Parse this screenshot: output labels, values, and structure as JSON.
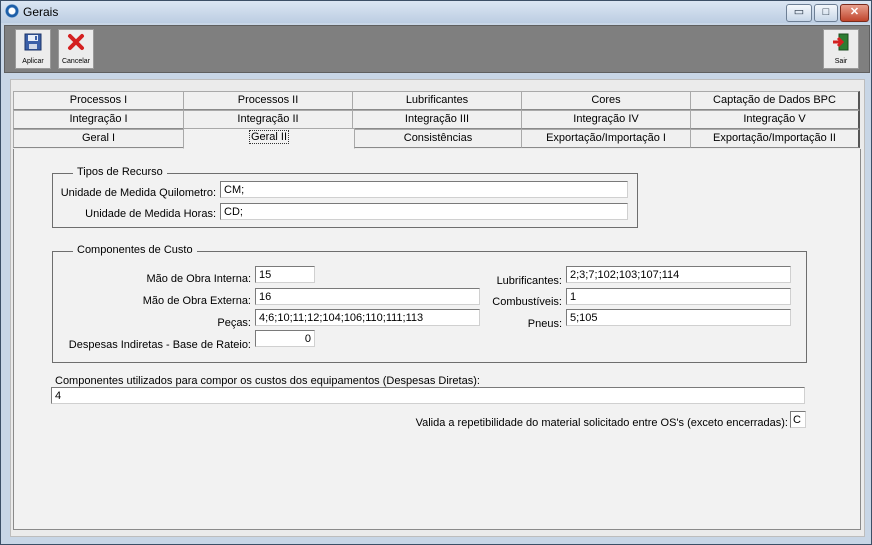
{
  "window": {
    "title": "Gerais",
    "minimize": "▭",
    "maximize": "□",
    "close": "✕"
  },
  "toolbar": {
    "apply_label": "Aplicar",
    "cancel_label": "Cancelar",
    "exit_label": "Sair"
  },
  "tabs": {
    "row1": [
      "Processos I",
      "Processos II",
      "Lubrificantes",
      "Cores",
      "Captação de Dados BPC"
    ],
    "row2": [
      "Integração I",
      "Integração II",
      "Integração III",
      "Integração IV",
      "Integração V"
    ],
    "row3": [
      "Geral I",
      "Geral II",
      "Consistências",
      "Exportação/Importação I",
      "Exportação/Importação II"
    ],
    "active": "Geral II"
  },
  "tipos_recurso": {
    "title": "Tipos de Recurso",
    "quilometro_label": "Unidade de Medida Quilometro:",
    "quilometro_value": "CM;",
    "horas_label": "Unidade de Medida Horas:",
    "horas_value": "CD;"
  },
  "componentes_custo": {
    "title": "Componentes de Custo",
    "mao_obra_interna_label": "Mão de Obra Interna:",
    "mao_obra_interna_value": "15",
    "mao_obra_externa_label": "Mão de Obra Externa:",
    "mao_obra_externa_value": "16",
    "pecas_label": "Peças:",
    "pecas_value": "4;6;10;11;12;104;106;110;111;113",
    "despesas_label": "Despesas Indiretas - Base de Rateio:",
    "despesas_value": "0",
    "lubrificantes_label": "Lubrificantes:",
    "lubrificantes_value": "2;3;7;102;103;107;114",
    "combustiveis_label": "Combustíveis:",
    "combustiveis_value": "1",
    "pneus_label": "Pneus:",
    "pneus_value": "5;105"
  },
  "despesas_diretas": {
    "label": "Componentes utilizados para compor os custos dos equipamentos (Despesas Diretas):",
    "value": "4"
  },
  "repetibilidade": {
    "label": "Valida a repetibilidade do material solicitado entre OS's (exceto encerradas):",
    "value": "C"
  }
}
